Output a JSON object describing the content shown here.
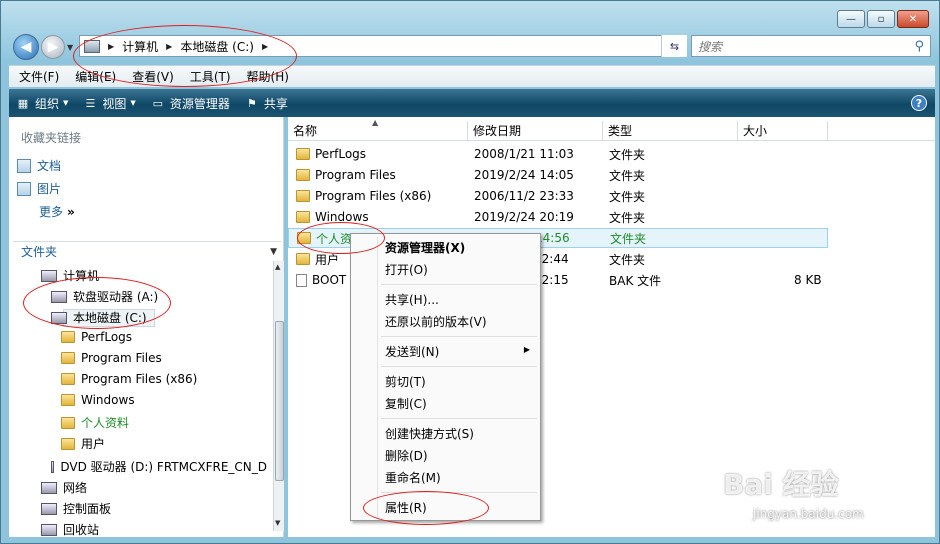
{
  "address": {
    "segments": [
      "计算机",
      "本地磁盘 (C:)"
    ],
    "search_placeholder": "搜索"
  },
  "menubar": [
    "文件(F)",
    "编辑(E)",
    "查看(V)",
    "工具(T)",
    "帮助(H)"
  ],
  "toolbar": {
    "organize": "组织",
    "views": "视图",
    "explorer": "资源管理器",
    "share": "共享"
  },
  "left_pane": {
    "favorites_title": "收藏夹链接",
    "favorites": [
      "文档",
      "图片"
    ],
    "more": "更多",
    "folders_title": "文件夹",
    "tree": [
      "计算机",
      "软盘驱动器 (A:)",
      "本地磁盘 (C:)",
      "PerfLogs",
      "Program Files",
      "Program Files (x86)",
      "Windows",
      "个人资料",
      "用户",
      "DVD 驱动器 (D:) FRTMCXFRE_CN_D",
      "网络",
      "控制面板",
      "回收站"
    ]
  },
  "columns": [
    "名称",
    "修改日期",
    "类型",
    "大小"
  ],
  "files": [
    {
      "name": "PerfLogs",
      "date": "2008/1/21 11:03",
      "type": "文件夹",
      "size": ""
    },
    {
      "name": "Program Files",
      "date": "2019/2/24 14:05",
      "type": "文件夹",
      "size": ""
    },
    {
      "name": "Program Files (x86)",
      "date": "2006/11/2 23:33",
      "type": "文件夹",
      "size": ""
    },
    {
      "name": "Windows",
      "date": "2019/2/24 20:19",
      "type": "文件夹",
      "size": ""
    },
    {
      "name": "个人资",
      "date": "14:56",
      "type": "文件夹",
      "size": ""
    },
    {
      "name": "用户",
      "date": "12:44",
      "type": "文件夹",
      "size": ""
    },
    {
      "name": "BOOT",
      "date": "12:15",
      "type": "BAK 文件",
      "size": "8 KB"
    }
  ],
  "context_menu": [
    "资源管理器(X)",
    "打开(O)",
    "共享(H)...",
    "还原以前的版本(V)",
    "发送到(N)",
    "剪切(T)",
    "复制(C)",
    "创建快捷方式(S)",
    "删除(D)",
    "重命名(M)",
    "属性(R)"
  ],
  "watermark": {
    "main": "Bai 经验",
    "sub": "jingyan.baidu.com"
  }
}
